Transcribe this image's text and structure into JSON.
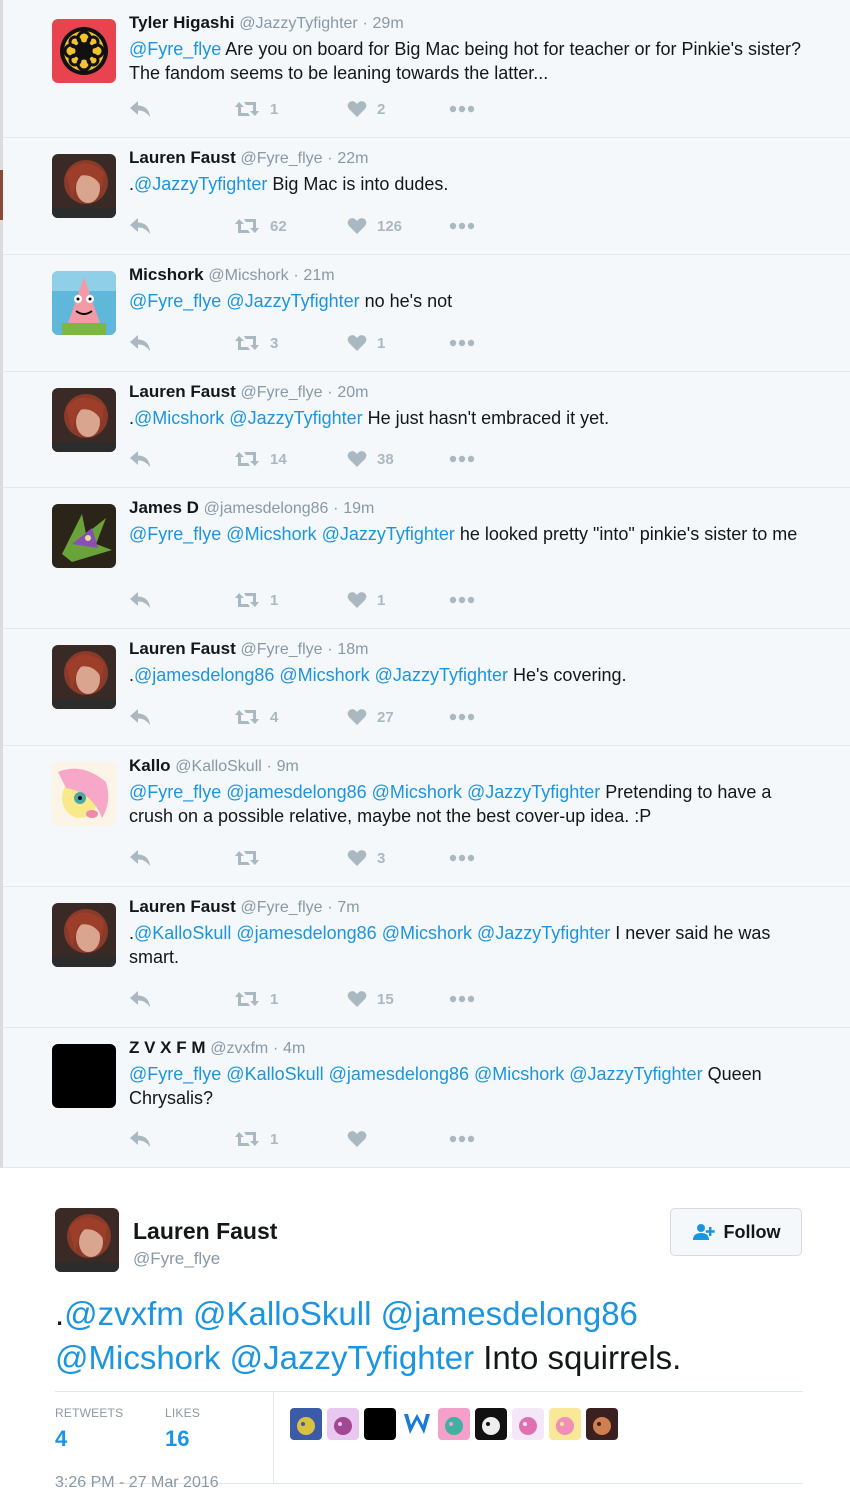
{
  "replies": [
    {
      "name": "Tyler Higashi",
      "handle": "@JazzyTyfighter",
      "dot": "·",
      "time": "29m",
      "mentions": "@Fyre_flye",
      "text": " Are you on board for Big Mac being hot for teacher or for Pinkie's sister? The fandom seems to be leaning towards the latter...",
      "retweets": "1",
      "likes": "2",
      "avatar": "mon-crest"
    },
    {
      "name": "Lauren Faust",
      "handle": "@Fyre_flye",
      "dot": "·",
      "time": "22m",
      "prefix": ".",
      "mentions": "@JazzyTyfighter",
      "text": " Big Mac is into dudes.",
      "retweets": "62",
      "likes": "126",
      "avatar": "lauren-photo"
    },
    {
      "name": "Micshork",
      "handle": "@Micshork",
      "dot": "·",
      "time": "21m",
      "mentions": "@Fyre_flye @JazzyTyfighter",
      "text": " no he's not",
      "retweets": "3",
      "likes": "1",
      "avatar": "patrick-cartoon"
    },
    {
      "name": "Lauren Faust",
      "handle": "@Fyre_flye",
      "dot": "·",
      "time": "20m",
      "prefix": ".",
      "mentions": "@Micshork @JazzyTyfighter",
      "text": " He just hasn't embraced it yet.",
      "retweets": "14",
      "likes": "38",
      "avatar": "lauren-photo"
    },
    {
      "name": "James D",
      "handle": "@jamesdelong86",
      "dot": "·",
      "time": "19m",
      "mentions": "@Fyre_flye @Micshork @JazzyTyfighter",
      "text": " he looked pretty \"into\" pinkie's sister to me",
      "retweets": "1",
      "likes": "1",
      "avatar": "dragon-art"
    },
    {
      "name": "Lauren Faust",
      "handle": "@Fyre_flye",
      "dot": "·",
      "time": "18m",
      "prefix": ".",
      "mentions": "@jamesdelong86 @Micshork @JazzyTyfighter",
      "text": " He's covering.",
      "retweets": "4",
      "likes": "27",
      "avatar": "lauren-photo"
    },
    {
      "name": "Kallo",
      "handle": "@KalloSkull",
      "dot": "·",
      "time": "9m",
      "mentions": "@Fyre_flye @jamesdelong86 @Micshork @JazzyTyfighter",
      "text": " Pretending to have a crush on a possible relative, maybe not the best cover-up idea. :P",
      "retweets": "",
      "likes": "3",
      "avatar": "pony-art"
    },
    {
      "name": "Lauren Faust",
      "handle": "@Fyre_flye",
      "dot": "·",
      "time": "7m",
      "prefix": ".",
      "mentions": "@KalloSkull @jamesdelong86 @Micshork @JazzyTyfighter",
      "text": " I never said he was smart.",
      "retweets": "1",
      "likes": "15",
      "avatar": "lauren-photo"
    },
    {
      "name": "Z V X F M",
      "handle": "@zvxfm",
      "dot": "·",
      "time": "4m",
      "mentions": "@Fyre_flye @KalloSkull @jamesdelong86 @Micshork @JazzyTyfighter",
      "text": " Queen Chrysalis?",
      "retweets": "1",
      "likes": "",
      "avatar": "black-square"
    }
  ],
  "main_tweet": {
    "name": "Lauren Faust",
    "handle": "@Fyre_flye",
    "follow_label": "Follow",
    "prefix": ".",
    "mentions_line1": "@zvxfm @KalloSkull @jamesdelong86",
    "mentions_line2": "@Micshork @JazzyTyfighter",
    "text": " Into squirrels.",
    "retweets_label": "RETWEETS",
    "retweets": "4",
    "likes_label": "LIKES",
    "likes": "16",
    "timestamp": "3:26 PM - 27 Mar 2016",
    "liker_avatars": [
      "pony-blue",
      "pony-purple",
      "black-avatar",
      "w-logo",
      "pony-pink",
      "black-creature",
      "pony-white",
      "pony-yellow",
      "dark-photo"
    ]
  },
  "colors": {
    "mention": "#1b95e0",
    "muted": "#8899a6",
    "icon": "#aab8c2",
    "bg": "#f5f8fa"
  }
}
